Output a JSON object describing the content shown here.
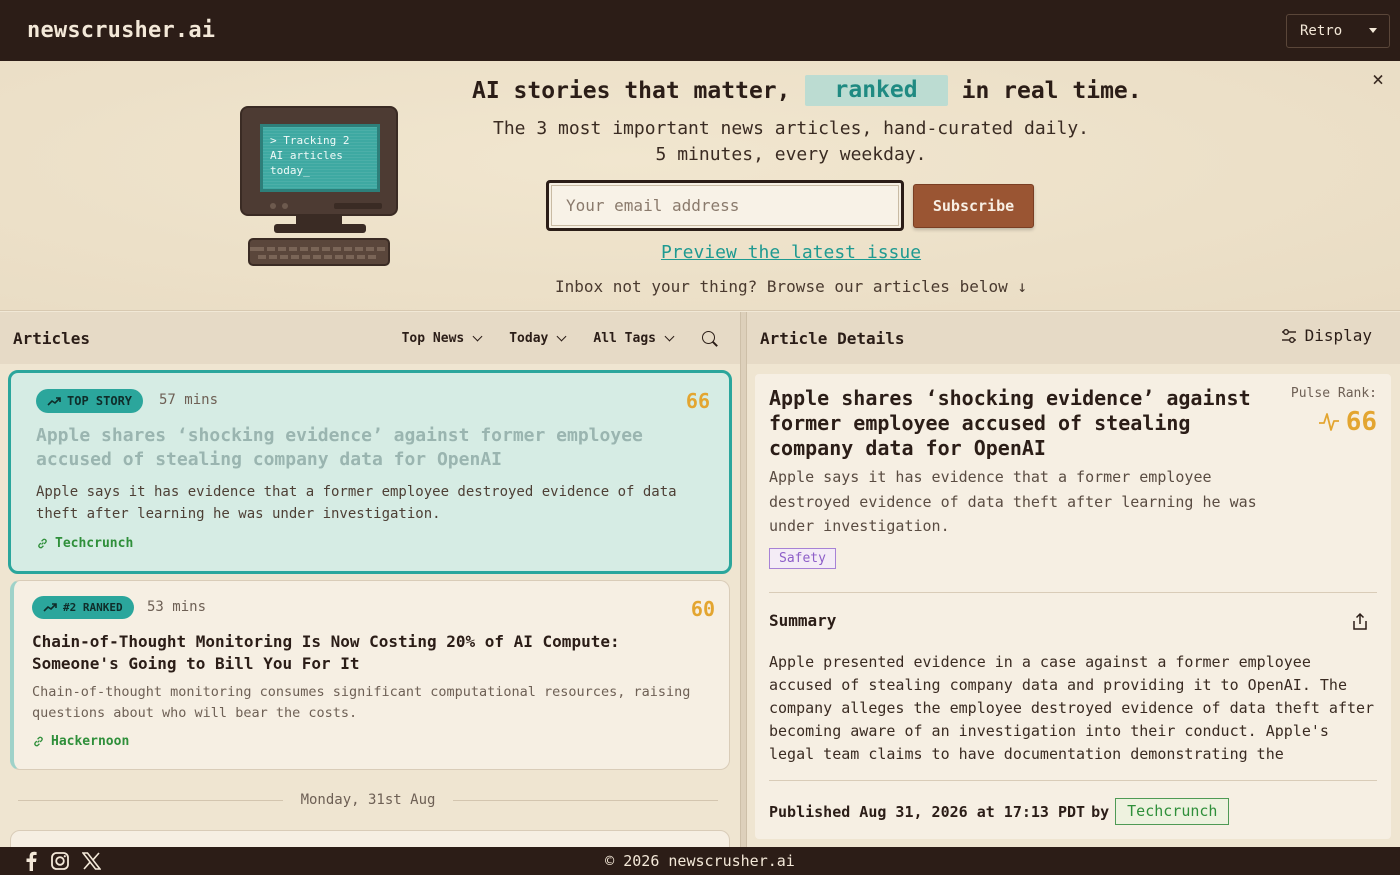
{
  "header": {
    "brand": "newscrusher.ai",
    "theme_label": "Retro"
  },
  "hero": {
    "title_before": "AI stories that matter,",
    "title_highlight": "ranked",
    "title_after": "in real time.",
    "sub_line1": "The 3 most important news articles, hand-curated daily.",
    "sub_line2": "5 minutes, every weekday.",
    "email_placeholder": "Your email address",
    "subscribe_label": "Subscribe",
    "preview_link": "Preview the latest issue",
    "browse_text": "Inbox not your thing? Browse our articles below ↓",
    "screen_text": "> Tracking 2\nAI articles\ntoday_",
    "close_symbol": "×"
  },
  "articles_panel": {
    "title": "Articles",
    "filters": [
      "Top News",
      "Today",
      "All Tags"
    ],
    "articles": [
      {
        "badge": "TOP STORY",
        "time": "57 mins",
        "score": "66",
        "title": "Apple shares ‘shocking evidence’ against former employee accused of stealing company data for OpenAI",
        "description": "Apple says it has evidence that a former employee destroyed evidence of data theft after learning he was under investigation.",
        "source": "Techcrunch"
      },
      {
        "badge": "#2 RANKED",
        "time": "53 mins",
        "score": "60",
        "title": "Chain-of-Thought Monitoring Is Now Costing 20% of AI Compute: Someone's Going to Bill You For It",
        "description": "Chain-of-thought monitoring consumes significant computational resources, raising questions about who will bear the costs.",
        "source": "Hackernoon"
      }
    ],
    "date_separator": "Monday, 31st Aug"
  },
  "details_panel": {
    "title": "Article Details",
    "display_label": "Display",
    "article_title": "Apple shares ‘shocking evidence’ against former employee accused of stealing company data for OpenAI",
    "pulse_label": "Pulse Rank:",
    "pulse_score": "66",
    "description": "Apple says it has evidence that a former employee destroyed evidence of data theft after learning he was under investigation.",
    "tag": "Safety",
    "summary_title": "Summary",
    "summary_text": "Apple presented evidence in a case against a former employee accused of stealing company data and providing it to OpenAI. The company alleges the employee destroyed evidence of data theft after becoming aware of an investigation into their conduct. Apple's legal team claims to have documentation demonstrating the",
    "published_text": "Published Aug 31, 2026 at 17:13 PDT",
    "by_label": "by",
    "source": "Techcrunch"
  },
  "footer": {
    "copyright": "© 2026 newscrusher.ai"
  },
  "colors": {
    "accent_teal": "#2ba69c",
    "score_orange": "#e3a530",
    "subscribe_brown": "#9a5533",
    "dark_bg": "#2c1d17"
  }
}
